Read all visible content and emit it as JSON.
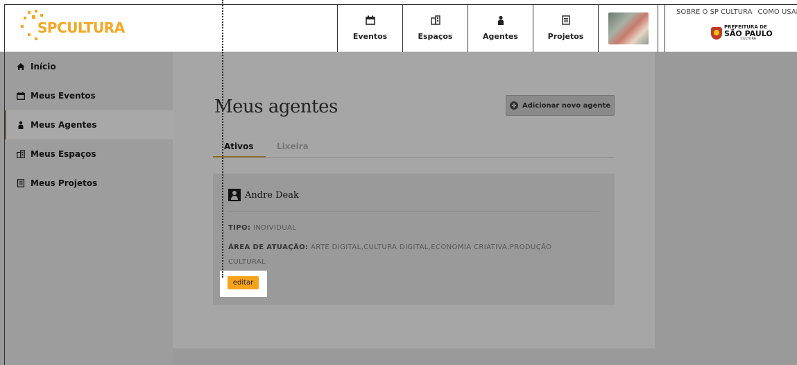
{
  "logo": {
    "sp": "SP",
    "rest": "CULTURA"
  },
  "nav": [
    {
      "label": "Eventos",
      "icon": "calendar-icon"
    },
    {
      "label": "Espaços",
      "icon": "building-icon"
    },
    {
      "label": "Agentes",
      "icon": "person-icon"
    },
    {
      "label": "Projetos",
      "icon": "document-icon"
    }
  ],
  "header_links": {
    "about": "SOBRE O SP CULTURA",
    "how": "COMO USAR"
  },
  "prefeitura": {
    "small": "PREFEITURA DE",
    "big": "SÃO PAULO",
    "sub": "CULTURA"
  },
  "sidebar": {
    "items": [
      {
        "label": "Início",
        "icon": "home-icon",
        "active": false
      },
      {
        "label": "Meus Eventos",
        "icon": "calendar-icon",
        "active": false
      },
      {
        "label": "Meus Agentes",
        "icon": "person-icon",
        "active": true
      },
      {
        "label": "Meus Espaços",
        "icon": "building-icon",
        "active": false
      },
      {
        "label": "Meus Projetos",
        "icon": "document-icon",
        "active": false
      }
    ]
  },
  "main": {
    "title": "Meus agentes",
    "add_button": "Adicionar novo agente",
    "tabs": [
      {
        "label": "Ativos",
        "active": true
      },
      {
        "label": "Lixeira",
        "active": false
      }
    ],
    "agent": {
      "name": "Andre Deak",
      "tipo_label": "TIPO:",
      "tipo_value": "INDIVIDUAL",
      "area_label": "ÁREA DE ATUAÇÃO:",
      "area_value": "ARTE DIGITAL,CULTURA DIGITAL,ECONOMIA CRIATIVA,PRODUÇÃO CULTURAL",
      "edit_label": "editar"
    }
  },
  "colors": {
    "accent": "#f6a31b",
    "overlay": "#9a9a9a"
  }
}
